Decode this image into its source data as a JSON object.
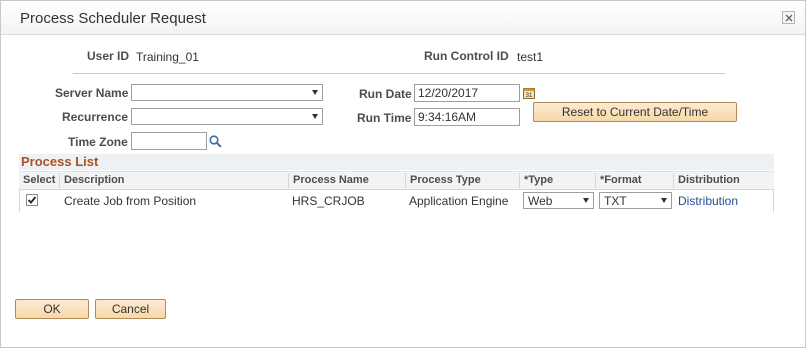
{
  "dialog": {
    "title": "Process Scheduler Request",
    "close_icon": "close-icon"
  },
  "header": {
    "user_id_label": "User ID",
    "user_id_value": "Training_01",
    "run_control_label": "Run Control ID",
    "run_control_value": "test1"
  },
  "form": {
    "server_name_label": "Server Name",
    "server_name_value": "",
    "recurrence_label": "Recurrence",
    "recurrence_value": "",
    "time_zone_label": "Time Zone",
    "time_zone_value": "",
    "run_date_label": "Run Date",
    "run_date_value": "12/20/2017",
    "run_time_label": "Run Time",
    "run_time_value": "9:34:16AM",
    "reset_button": "Reset to Current Date/Time",
    "calendar_icon": "calendar-icon",
    "lookup_icon": "search-icon"
  },
  "process_list": {
    "title": "Process List",
    "columns": [
      "Select",
      "Description",
      "Process Name",
      "Process Type",
      "*Type",
      "*Format",
      "Distribution"
    ],
    "rows": [
      {
        "select": true,
        "description": "Create Job from Position",
        "process_name": "HRS_CRJOB",
        "process_type": "Application Engine",
        "type": "Web",
        "format": "TXT",
        "distribution": "Distribution"
      }
    ]
  },
  "footer": {
    "ok_button": "OK",
    "cancel_button": "Cancel"
  },
  "colors": {
    "section_title": "#a5522a",
    "link": "#1f4e96",
    "button_fill": "#f7d8a8"
  }
}
